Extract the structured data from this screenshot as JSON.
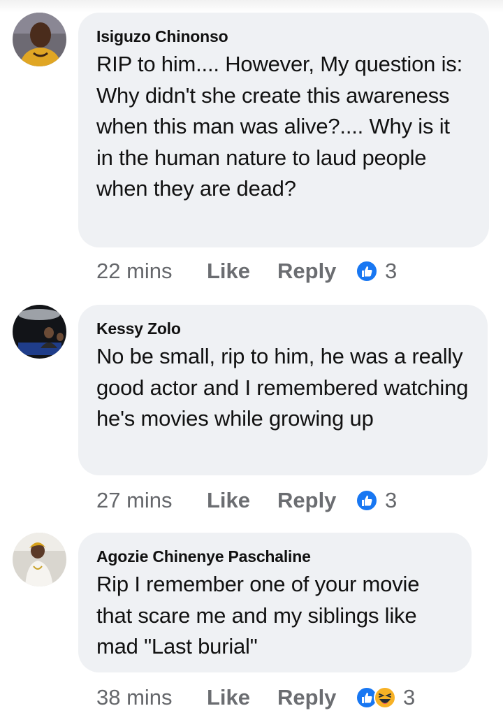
{
  "comments": [
    {
      "author": "Isiguzo Chinonso",
      "text": "RIP to him.... However, My question is: Why didn't she create this awareness when this man was alive?.... Why is it in the human nature to laud people when they are dead?",
      "time": "22 mins",
      "like_label": "Like",
      "reply_label": "Reply",
      "reaction_count": "3",
      "reactions": [
        "like-icon"
      ]
    },
    {
      "author": "Kessy Zolo",
      "text": "No be small, rip to him, he was a really good actor and I remembered watching he's movies while growing up",
      "time": "27 mins",
      "like_label": "Like",
      "reply_label": "Reply",
      "reaction_count": "3",
      "reactions": [
        "like-icon"
      ]
    },
    {
      "author": "Agozie Chinenye Paschaline",
      "text": "Rip I remember one of your movie that scare me and my siblings like mad \"Last burial\"",
      "time": "38 mins",
      "like_label": "Like",
      "reply_label": "Reply",
      "reaction_count": "3",
      "reactions": [
        "like-icon",
        "haha-icon"
      ]
    }
  ],
  "colors": {
    "bubble": "#eff1f4",
    "meta_text": "#65676b",
    "like_blue": "#1877f2",
    "haha_yellow": "#f7b125"
  }
}
